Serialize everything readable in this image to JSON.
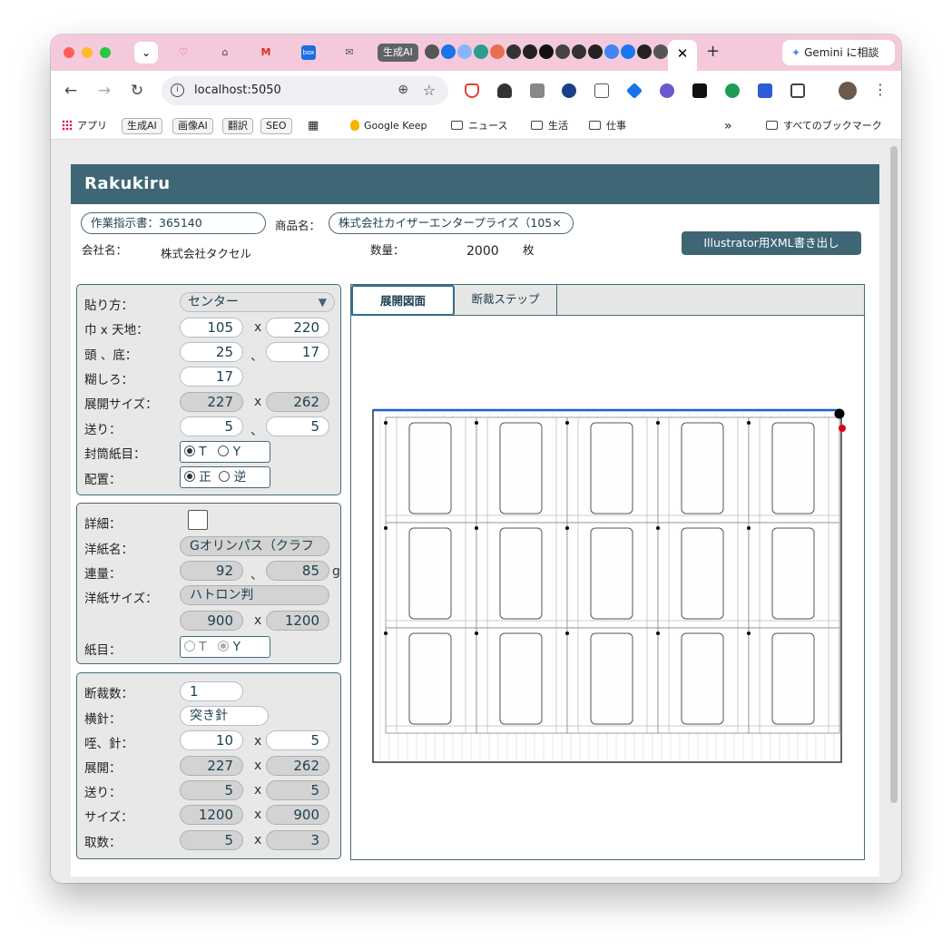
{
  "browser": {
    "ai_tab_group": "生成AI",
    "close_tab_glyph": "✕",
    "new_tab_glyph": "+",
    "gemini_label": "Gemini に相談",
    "url": "localhost:5050",
    "bookmarks": {
      "apps": "アプリ",
      "gen_ai": "生成AI",
      "image_ai": "画像AI",
      "translate": "翻訳",
      "seo": "SEO",
      "keep": "Google Keep",
      "news": "ニュース",
      "life": "生活",
      "work": "仕事",
      "more": "»",
      "all": "すべてのブックマーク"
    }
  },
  "app": {
    "title": "Rakukiru",
    "order": "作業指示書：365140",
    "product_label": "商品名：",
    "product_value": "株式会社カイザーエンタープライズ（105×",
    "company_label": "会社名：",
    "company_value": "株式会社タクセル",
    "qty_label": "数量：",
    "qty_value": "2000",
    "qty_unit": "枚",
    "xml_button": "Illustrator用XML書き出し"
  },
  "panel1": {
    "paste_label": "貼り方：",
    "paste_value": "センター",
    "size_label": "巾 x 天地：",
    "width": "105",
    "height": "220",
    "headbottom_label": "頭 、底：",
    "head": "25",
    "bottom": "17",
    "glue_label": "糊しろ：",
    "glue": "17",
    "unfold_label": "展開サイズ：",
    "unfold_w": "227",
    "unfold_h": "262",
    "feed_label": "送り：",
    "feed_a": "5",
    "feed_b": "5",
    "grain_label": "封筒紙目：",
    "grain_t": "T",
    "grain_y": "Y",
    "place_label": "配置：",
    "place_normal": "正",
    "place_reverse": "逆"
  },
  "panel2": {
    "detail_label": "詳細：",
    "paper_label": "洋紙名：",
    "paper_value": "Gオリンパス（クラフ",
    "weight_label": "連量：",
    "weight_a": "92",
    "weight_b": "85",
    "weight_unit": "g",
    "paper_size_label": "洋紙サイズ：",
    "paper_size_value": "ハトロン判",
    "paper_w": "900",
    "paper_h": "1200",
    "grain_label": "紙目：",
    "grain_t": "T",
    "grain_y": "Y"
  },
  "panel3": {
    "cuts_label": "断裁数：",
    "cuts": "1",
    "side_guide_label": "横針：",
    "side_guide": "突き針",
    "gripper_label": "咥、針：",
    "gripper_a": "10",
    "gripper_b": "5",
    "unfold_label": "展開：",
    "unfold_a": "227",
    "unfold_b": "262",
    "feed_label": "送り：",
    "feed_a": "5",
    "feed_b": "5",
    "size_label": "サイズ：",
    "size_a": "1200",
    "size_b": "900",
    "count_label": "取数：",
    "count_a": "5",
    "count_b": "3"
  },
  "separators": {
    "x": "x",
    "comma": "、"
  },
  "tabs": {
    "layout": "展開図面",
    "steps": "断裁ステップ"
  },
  "layout": {
    "cols": 5,
    "rows": 3,
    "accent": "#1a5fd0",
    "marker_black": "#000000",
    "marker_red": "#e0001b"
  }
}
